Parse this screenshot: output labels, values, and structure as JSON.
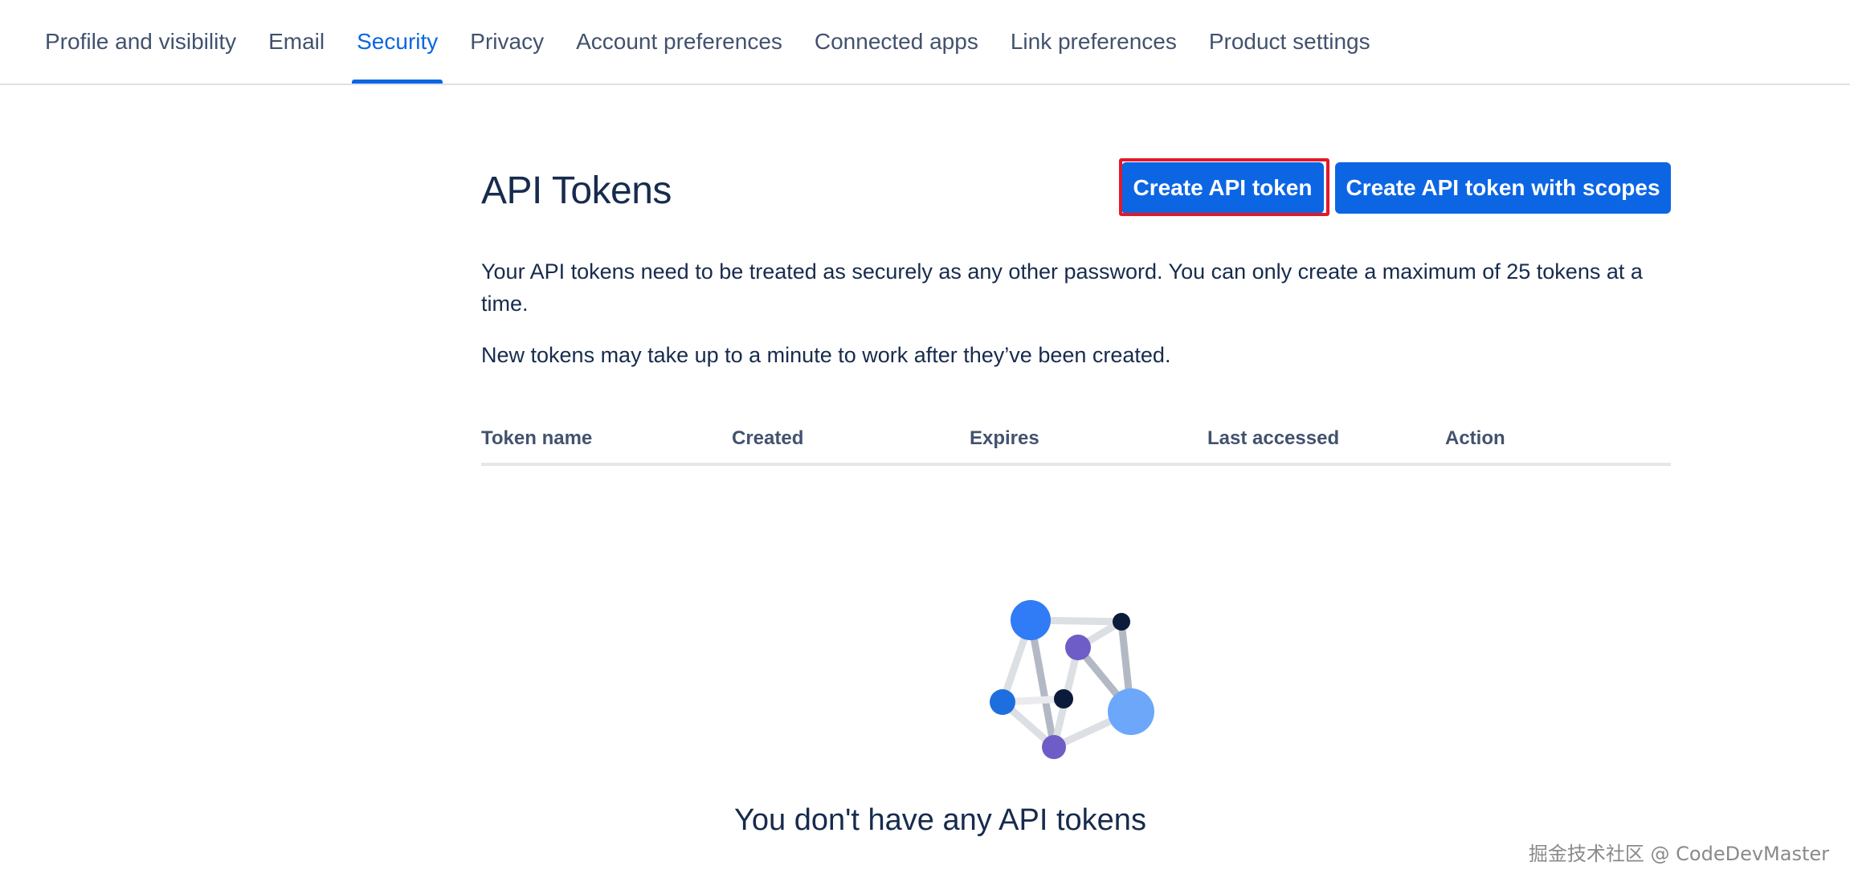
{
  "nav": {
    "tabs": [
      {
        "label": "Profile and visibility",
        "active": false
      },
      {
        "label": "Email",
        "active": false
      },
      {
        "label": "Security",
        "active": true
      },
      {
        "label": "Privacy",
        "active": false
      },
      {
        "label": "Account preferences",
        "active": false
      },
      {
        "label": "Connected apps",
        "active": false
      },
      {
        "label": "Link preferences",
        "active": false
      },
      {
        "label": "Product settings",
        "active": false
      }
    ],
    "active_color": "#0C66E4"
  },
  "main": {
    "title": "API Tokens",
    "create_button": "Create API token",
    "create_scopes_button": "Create API token with scopes",
    "description": "Your API tokens need to be treated as securely as any other password. You can only create a maximum of 25 tokens at a time.",
    "note": "New tokens may take up to a minute to work after they’ve been created.",
    "table": {
      "columns": [
        "Token name",
        "Created",
        "Expires",
        "Last accessed",
        "Action"
      ],
      "rows": []
    },
    "empty_state": {
      "illustration_icon": "network-graph-illustration",
      "title": "You don't have any API tokens"
    }
  },
  "colors": {
    "primary_button": "#0C66E4",
    "highlight_outline": "#E11A2B",
    "text": "#172B4D",
    "muted_text": "#42526E"
  },
  "watermark": "掘金技术社区 @ CodeDevMaster"
}
